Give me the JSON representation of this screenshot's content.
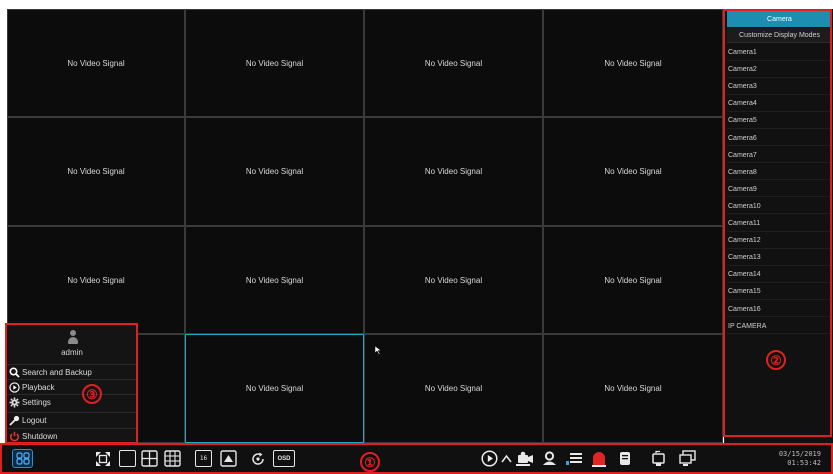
{
  "grid": {
    "cells": [
      "No Video Signal",
      "No Video Signal",
      "No Video Signal",
      "No Video Signal",
      "No Video Signal",
      "No Video Signal",
      "No Video Signal",
      "No Video Signal",
      "No Video Signal",
      "No Video Signal",
      "No Video Signal",
      "No Video Signal",
      "",
      "No Video Signal",
      "No Video Signal",
      "No Video Signal"
    ],
    "selected_index": 13,
    "selection_color": "#1fa9c4"
  },
  "sidebar": {
    "header": "Camera",
    "customize": "Customize Display Modes",
    "cameras": [
      "Camera1",
      "Camera2",
      "Camera3",
      "Camera4",
      "Camera5",
      "Camera6",
      "Camera7",
      "Camera8",
      "Camera9",
      "Camera10",
      "Camera11",
      "Camera12",
      "Camera13",
      "Camera14",
      "Camera15",
      "Camera16",
      "IP CAMERA"
    ],
    "accent": "#1d8db1"
  },
  "user_panel": {
    "username": "admin",
    "items": [
      {
        "label": "Search and Backup",
        "icon": "search-icon"
      },
      {
        "label": "Playback",
        "icon": "play-circle-icon"
      },
      {
        "label": "Settings",
        "icon": "gear-icon"
      },
      {
        "label": "Logout",
        "icon": "key-icon"
      },
      {
        "label": "Shutdown",
        "icon": "power-icon"
      }
    ]
  },
  "callouts": {
    "taskbar": "①",
    "sidebar": "②",
    "menu": "③",
    "color": "#e02020"
  },
  "taskbar": {
    "layout_icons": [
      "start-menu-icon",
      "fullscreen-icon",
      "single-view-icon",
      "quad-view-icon",
      "nine-view-icon",
      "sixteen-view-icon",
      "pip-icon",
      "sequence-icon"
    ],
    "osd_label": "OSD",
    "sixteen_label": "16",
    "right_icons": [
      "play-icon",
      "expand-up-icon",
      "ptz-camera-icon",
      "person-icon",
      "volume-icon",
      "alarm-icon",
      "record-icon",
      "snapshot-icon",
      "display-icon"
    ]
  },
  "clock": {
    "date": "03/15/2019",
    "time": "01:53:42"
  }
}
